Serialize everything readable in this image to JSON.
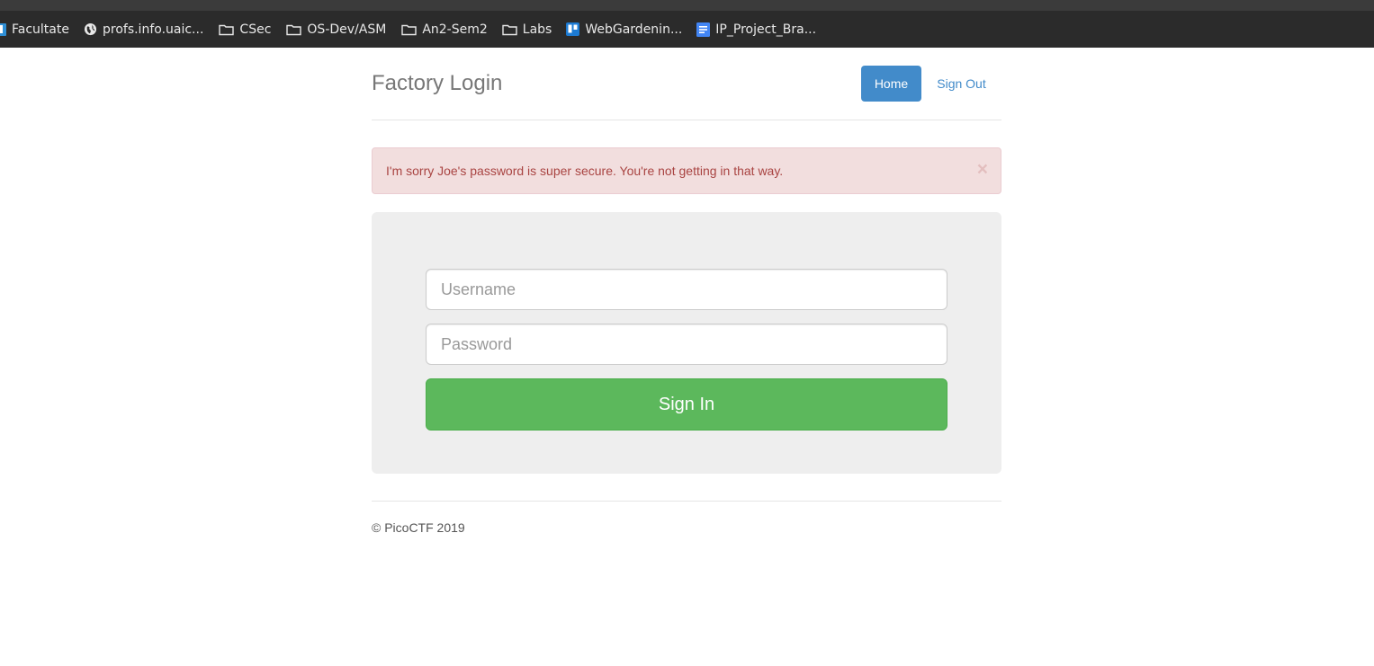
{
  "bookmarks": [
    {
      "label": "Facultate",
      "icon": "trello-icon"
    },
    {
      "label": "profs.info.uaic...",
      "icon": "globe-icon"
    },
    {
      "label": "CSec",
      "icon": "folder-icon"
    },
    {
      "label": "OS-Dev/ASM",
      "icon": "folder-icon"
    },
    {
      "label": "An2-Sem2",
      "icon": "folder-icon"
    },
    {
      "label": "Labs",
      "icon": "folder-icon"
    },
    {
      "label": "WebGardenin...",
      "icon": "trello-icon"
    },
    {
      "label": "IP_Project_Bra...",
      "icon": "document-icon"
    }
  ],
  "header": {
    "brand": "Factory Login",
    "nav": {
      "home": "Home",
      "sign_out": "Sign Out"
    }
  },
  "alert": {
    "message": "I'm sorry Joe's password is super secure. You're not getting in that way.",
    "close": "×"
  },
  "form": {
    "username_placeholder": "Username",
    "password_placeholder": "Password",
    "submit_label": "Sign In"
  },
  "footer": {
    "text": "© PicoCTF 2019"
  },
  "colors": {
    "primary": "#428bca",
    "success": "#5cb85c",
    "danger_bg": "#f2dede",
    "danger_text": "#a94442"
  }
}
